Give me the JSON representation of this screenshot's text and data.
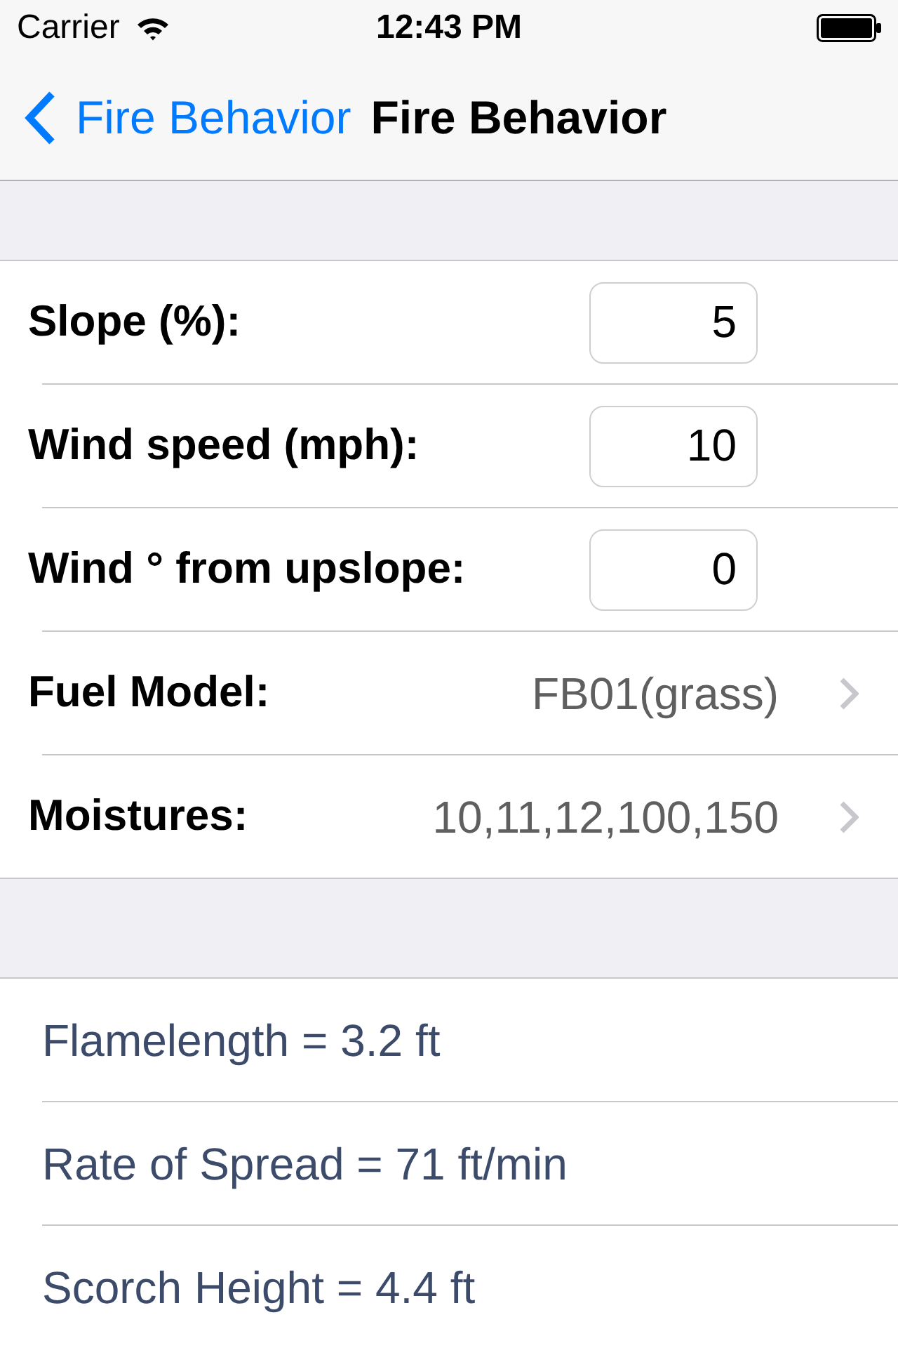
{
  "status_bar": {
    "carrier": "Carrier",
    "time": "12:43 PM"
  },
  "nav_bar": {
    "back_label": "Fire Behavior",
    "title": "Fire Behavior"
  },
  "inputs": [
    {
      "kind": "field",
      "label": "Slope (%):",
      "value": "5"
    },
    {
      "kind": "field",
      "label": "Wind speed (mph):",
      "value": "10"
    },
    {
      "kind": "field",
      "label": "Wind ° from upslope:",
      "value": "0"
    },
    {
      "kind": "disclosure",
      "label": "Fuel Model:",
      "value": "FB01(grass)"
    },
    {
      "kind": "disclosure",
      "label": "Moistures:",
      "value": "10,11,12,100,150"
    }
  ],
  "results": [
    "Flamelength = 3.2 ft",
    "Rate of Spread = 71 ft/min",
    "Scorch Height = 4.4 ft"
  ]
}
